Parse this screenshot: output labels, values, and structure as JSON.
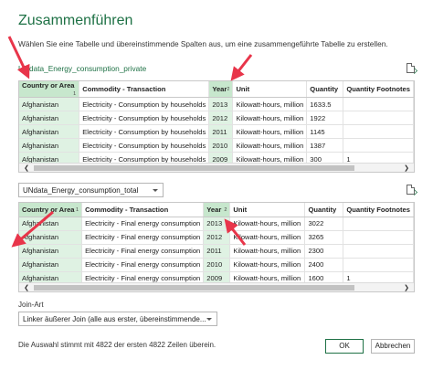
{
  "dialog": {
    "title": "Zusammenführen",
    "description": "Wählen Sie eine Tabelle und übereinstimmende Spalten aus, um eine zusammengeführte Tabelle zu erstellen."
  },
  "table1": {
    "name": "UNdata_Energy_consumption_private",
    "columns": [
      {
        "label": "Country or Area",
        "order": "1",
        "selected": true
      },
      {
        "label": "Commodity - Transaction",
        "order": "",
        "selected": false
      },
      {
        "label": "Year",
        "order": "2",
        "selected": true
      },
      {
        "label": "Unit",
        "order": "",
        "selected": false
      },
      {
        "label": "Quantity",
        "order": "",
        "selected": false
      },
      {
        "label": "Quantity Footnotes",
        "order": "",
        "selected": false
      }
    ],
    "rows": [
      [
        "Afghanistan",
        "Electricity - Consumption by households",
        "2013",
        "Kilowatt-hours, million",
        "1633.5",
        ""
      ],
      [
        "Afghanistan",
        "Electricity - Consumption by households",
        "2012",
        "Kilowatt-hours, million",
        "1922",
        ""
      ],
      [
        "Afghanistan",
        "Electricity - Consumption by households",
        "2011",
        "Kilowatt-hours, million",
        "1145",
        ""
      ],
      [
        "Afghanistan",
        "Electricity - Consumption by households",
        "2010",
        "Kilowatt-hours, million",
        "1387",
        ""
      ],
      [
        "Afghanistan",
        "Electricity - Consumption by households",
        "2009",
        "Kilowatt-hours, million",
        "300",
        "1"
      ]
    ]
  },
  "table2": {
    "selector_value": "UNdata_Energy_consumption_total",
    "columns": [
      {
        "label": "Country or Area",
        "order": "1",
        "selected": true
      },
      {
        "label": "Commodity - Transaction",
        "order": "",
        "selected": false
      },
      {
        "label": "Year",
        "order": "2",
        "selected": true
      },
      {
        "label": "Unit",
        "order": "",
        "selected": false
      },
      {
        "label": "Quantity",
        "order": "",
        "selected": false
      },
      {
        "label": "Quantity Footnotes",
        "order": "",
        "selected": false
      }
    ],
    "rows": [
      [
        "Afghanistan",
        "Electricity - Final energy consumption",
        "2013",
        "Kilowatt-hours, million",
        "3022",
        ""
      ],
      [
        "Afghanistan",
        "Electricity - Final energy consumption",
        "2012",
        "Kilowatt-hours, million",
        "3265",
        ""
      ],
      [
        "Afghanistan",
        "Electricity - Final energy consumption",
        "2011",
        "Kilowatt-hours, million",
        "2300",
        ""
      ],
      [
        "Afghanistan",
        "Electricity - Final energy consumption",
        "2010",
        "Kilowatt-hours, million",
        "2400",
        ""
      ],
      [
        "Afghanistan",
        "Electricity - Final energy consumption",
        "2009",
        "Kilowatt-hours, million",
        "1600",
        "1"
      ]
    ]
  },
  "join": {
    "label": "Join-Art",
    "value": "Linker äußerer Join (alle aus erster, übereinstimmende..."
  },
  "status": "Die Auswahl stimmt mit 4822 der ersten 4822 Zeilen überein.",
  "buttons": {
    "ok": "OK",
    "cancel": "Abbrechen"
  },
  "colors": {
    "accent": "#1e7145",
    "selected_header": "#c7e7cd",
    "selected_cell": "#dff2e3",
    "annotation_arrow": "#e8354a"
  }
}
